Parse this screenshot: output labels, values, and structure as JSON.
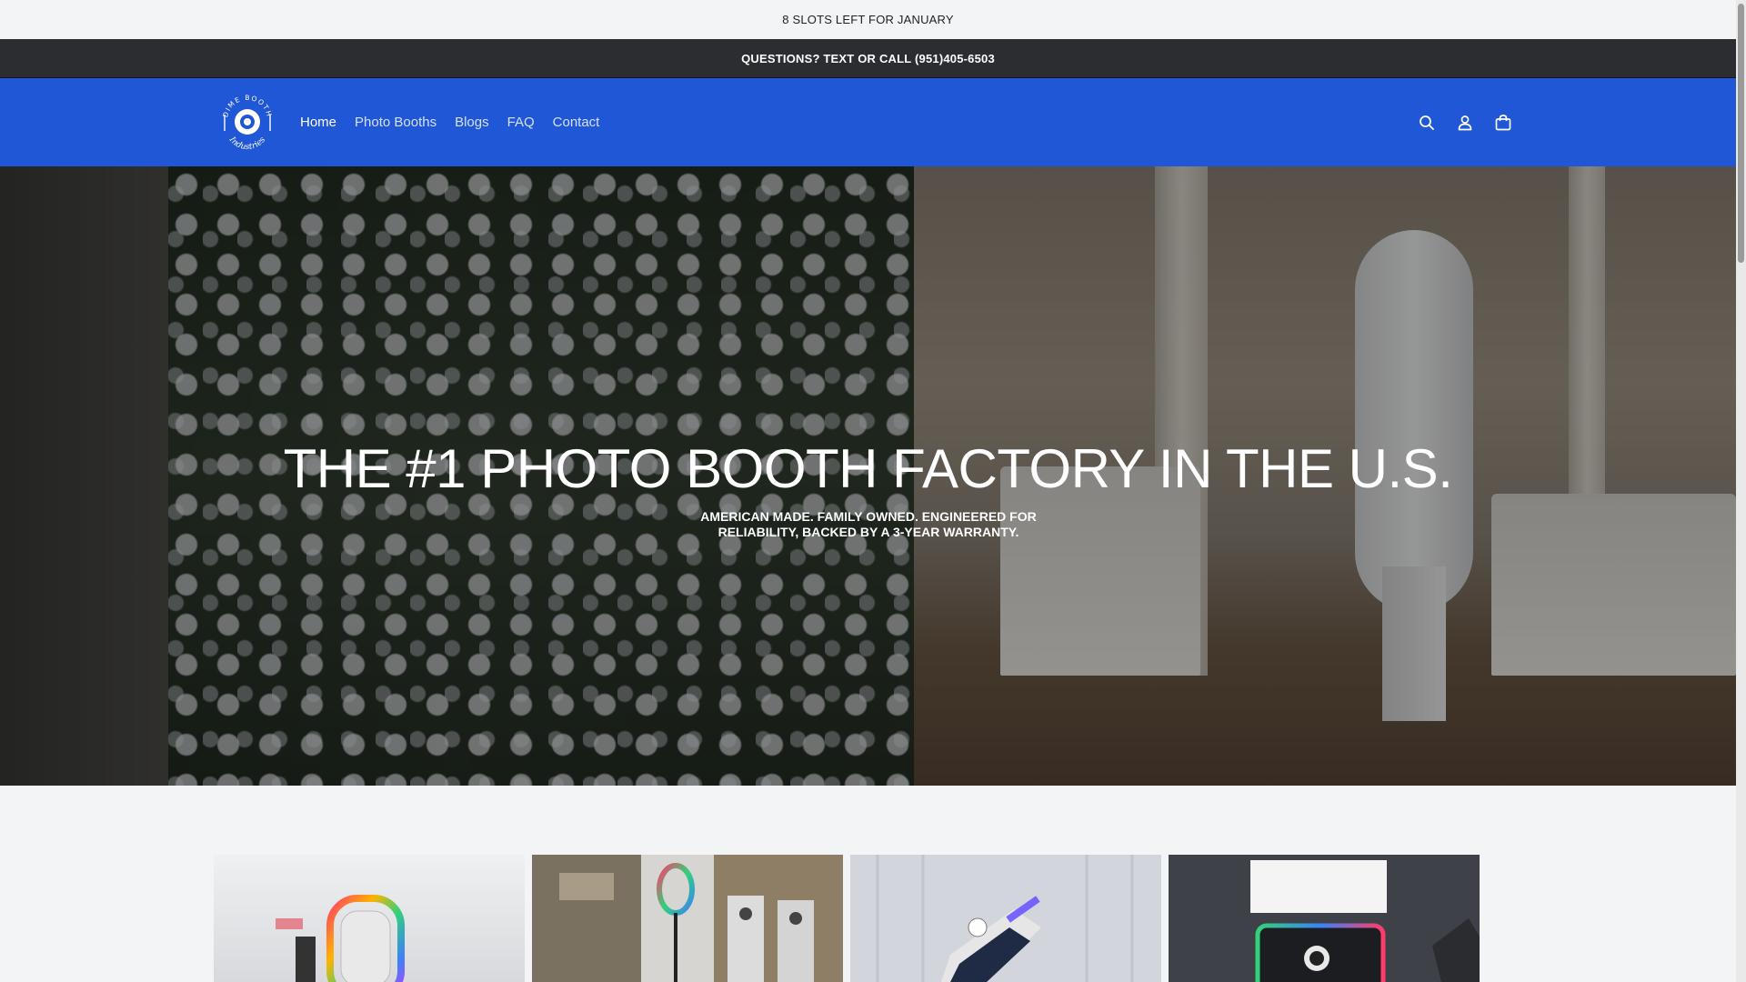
{
  "announcements": {
    "top": "8 SLOTS LEFT FOR JANUARY",
    "second": "QUESTIONS? TEXT OR CALL (951)405-6503"
  },
  "header": {
    "logo": {
      "brand_text": "DIME BOOTH Industries"
    },
    "nav": [
      {
        "label": "Home",
        "active": true
      },
      {
        "label": "Photo Booths",
        "active": false
      },
      {
        "label": "Blogs",
        "active": false
      },
      {
        "label": "FAQ",
        "active": false
      },
      {
        "label": "Contact",
        "active": false
      }
    ],
    "icons": [
      "search-icon",
      "account-icon",
      "cart-icon"
    ],
    "background_color": "#1f57d6"
  },
  "hero": {
    "title": "THE #1 PHOTO BOOTH FACTORY IN THE U.S.",
    "subtitle": "AMERICAN MADE. FAMILY OWNED. ENGINEERED FOR RELIABILITY, BACKED BY A 3-YEAR WARRANTY."
  },
  "products": [
    {
      "image": "rainbow-ring-booth"
    },
    {
      "image": "factory-ring-light-booths"
    },
    {
      "image": "angled-screen-booth"
    },
    {
      "image": "led-frame-booth"
    }
  ]
}
